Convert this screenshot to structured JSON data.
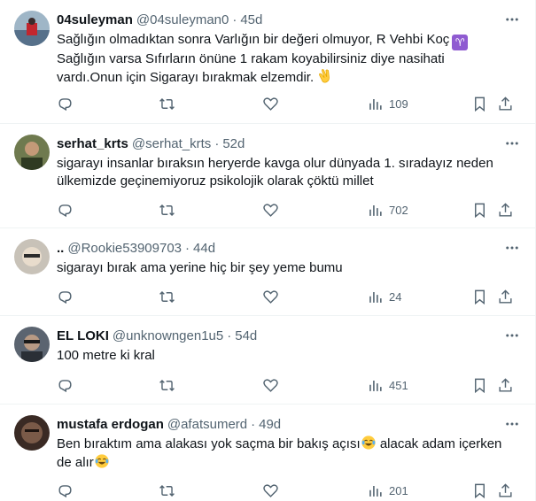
{
  "tweets": [
    {
      "name": "04suleyman",
      "handle": "@04suleyman0",
      "time": "45d",
      "lines": [
        "Sağlığın olmadıktan sonra Varlığın bir değeri olmuyor, R Vehbi Koç",
        "Sağlığın varsa Sıfırların önüne 1 rakam koyabilirsiniz diye nasihati",
        "vardı.Onun için Sigarayı bırakmak elzemdir."
      ],
      "emoji": [
        "aries-sign",
        "clapping-hands"
      ],
      "views": "109",
      "colors": {
        "avatar_bg": "#9fb6c7",
        "avatar_fg": "#c2262e"
      }
    },
    {
      "name": "serhat_krts",
      "handle": "@serhat_krts",
      "time": "52d",
      "lines": [
        "sigarayı insanlar bıraksın heryerde kavga olur dünyada 1. sıradayız neden",
        "ülkemizde geçinemiyoruz psikolojik olarak çöktü millet"
      ],
      "views": "702",
      "colors": {
        "avatar_bg": "#6f7a4f",
        "avatar_fg": "#2f3a22"
      }
    },
    {
      "name": "..",
      "handle": "@Rookie53909703",
      "time": "44d",
      "lines": [
        "sigarayı bırak ama yerine hiç bir şey yeme bumu"
      ],
      "views": "24",
      "colors": {
        "avatar_bg": "#c8c2b8",
        "avatar_fg": "#e8dccc"
      }
    },
    {
      "name": "EL LOKI",
      "handle": "@unknowngen1u5",
      "time": "54d",
      "lines": [
        "100 metre ki kral"
      ],
      "views": "451",
      "colors": {
        "avatar_bg": "#5b6470",
        "avatar_fg": "#2a2f36"
      }
    },
    {
      "name": "mustafa erdogan",
      "handle": "@afatsumerd",
      "time": "49d",
      "lines": [
        "Ben bıraktım ama alakası yok saçma bir bakış açısı",
        "alacak adam içerken",
        "de alır"
      ],
      "emoji": [
        "face-with-tears-of-joy"
      ],
      "views": "201",
      "colors": {
        "avatar_bg": "#3a2a24",
        "avatar_fg": "#7a5a48"
      }
    }
  ],
  "colors": {
    "text": "#0f1419",
    "secondary": "#536471",
    "divider": "#eff3f4",
    "emoji_yellow": "#ffcc3d",
    "aries_purple": "#8f5bd1"
  },
  "icons": [
    "more-icon",
    "reply-icon",
    "retweet-icon",
    "like-icon",
    "views-icon",
    "bookmark-icon",
    "share-icon"
  ]
}
